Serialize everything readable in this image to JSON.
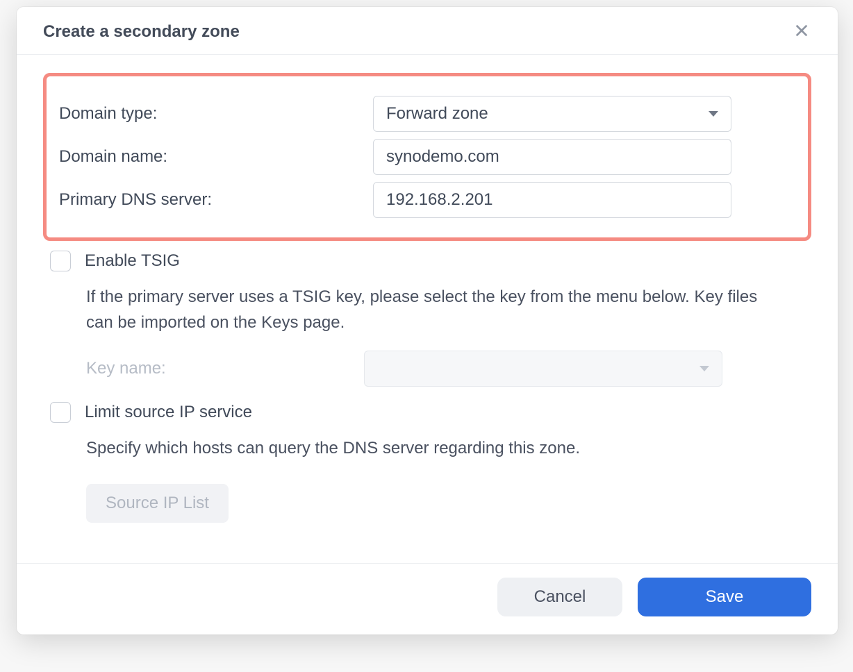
{
  "dialog": {
    "title": "Create a secondary zone"
  },
  "form": {
    "domain_type_label": "Domain type:",
    "domain_type_value": "Forward zone",
    "domain_name_label": "Domain name:",
    "domain_name_value": "synodemo.com",
    "primary_dns_label": "Primary DNS server:",
    "primary_dns_value": "192.168.2.201"
  },
  "tsig": {
    "checkbox_label": "Enable TSIG",
    "help_text": "If the primary server uses a TSIG key, please select the key from the menu below. Key files can be imported on the Keys page.",
    "key_name_label": "Key name:"
  },
  "limit_ip": {
    "checkbox_label": "Limit source IP service",
    "help_text": "Specify which hosts can query the DNS server regarding this zone.",
    "button_label": "Source IP List"
  },
  "footer": {
    "cancel_label": "Cancel",
    "save_label": "Save"
  }
}
